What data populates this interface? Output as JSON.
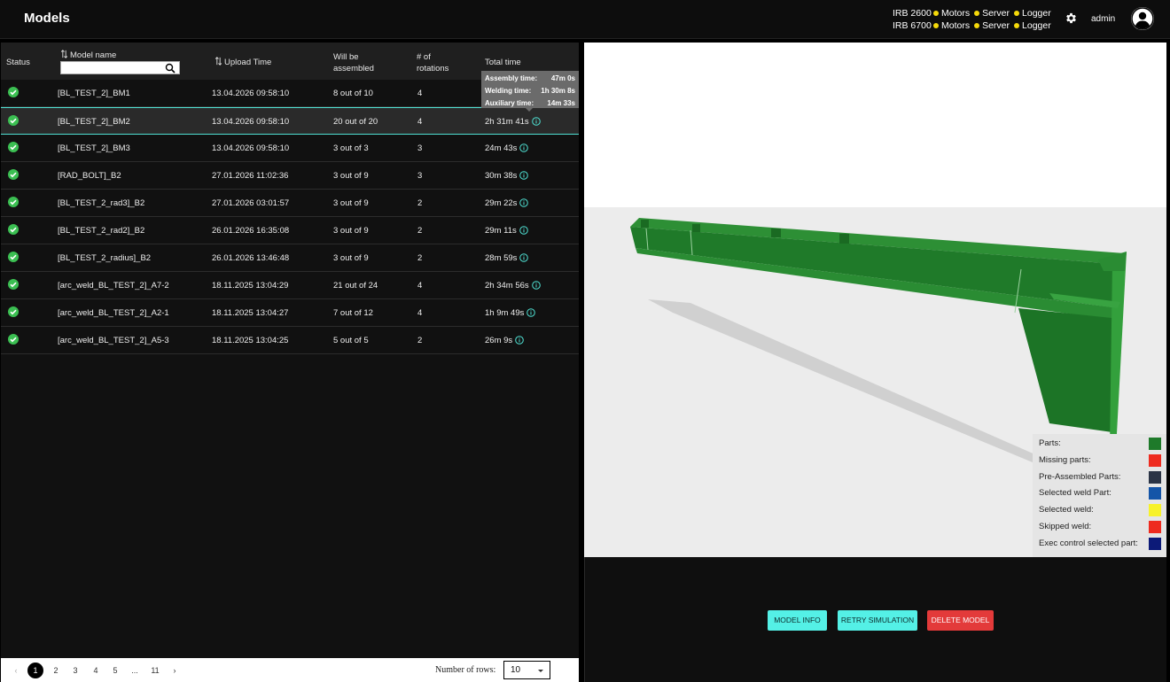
{
  "header": {
    "title": "Models",
    "robots": [
      {
        "name": "IRB 2600",
        "statuses": [
          "Motors",
          "Server",
          "Logger"
        ]
      },
      {
        "name": "IRB 6700",
        "statuses": [
          "Motors",
          "Server",
          "Logger"
        ]
      }
    ],
    "user": "admin",
    "status_color": "#f5d90a"
  },
  "table": {
    "columns": {
      "status": "Status",
      "model_name": "Model name",
      "upload_time": "Upload Time",
      "assembled_1": "Will be",
      "assembled_2": "assembled",
      "rotations_1": "# of",
      "rotations_2": "rotations",
      "total_time": "Total time"
    },
    "search_value": "",
    "rows": [
      {
        "name": "[BL_TEST_2]_BM1",
        "upload": "13.04.2026 09:58:10",
        "assembled": "8 out of 10",
        "rotations": "4",
        "total": ""
      },
      {
        "name": "[BL_TEST_2]_BM2",
        "upload": "13.04.2026 09:58:10",
        "assembled": "20 out of 20",
        "rotations": "4",
        "total": "2h 31m 41s"
      },
      {
        "name": "[BL_TEST_2]_BM3",
        "upload": "13.04.2026 09:58:10",
        "assembled": "3 out of 3",
        "rotations": "3",
        "total": "24m 43s"
      },
      {
        "name": "[RAD_BOLT]_B2",
        "upload": "27.01.2026 11:02:36",
        "assembled": "3 out of 9",
        "rotations": "3",
        "total": "30m 38s"
      },
      {
        "name": "[BL_TEST_2_rad3]_B2",
        "upload": "27.01.2026 03:01:57",
        "assembled": "3 out of 9",
        "rotations": "2",
        "total": "29m 22s"
      },
      {
        "name": "[BL_TEST_2_rad2]_B2",
        "upload": "26.01.2026 16:35:08",
        "assembled": "3 out of 9",
        "rotations": "2",
        "total": "29m 11s"
      },
      {
        "name": "[BL_TEST_2_radius]_B2",
        "upload": "26.01.2026 13:46:48",
        "assembled": "3 out of 9",
        "rotations": "2",
        "total": "28m 59s"
      },
      {
        "name": "[arc_weld_BL_TEST_2]_A7-2",
        "upload": "18.11.2025 13:04:29",
        "assembled": "21 out of 24",
        "rotations": "4",
        "total": "2h 34m 56s"
      },
      {
        "name": "[arc_weld_BL_TEST_2]_A2-1",
        "upload": "18.11.2025 13:04:27",
        "assembled": "7 out of 12",
        "rotations": "4",
        "total": "1h 9m 49s"
      },
      {
        "name": "[arc_weld_BL_TEST_2]_A5-3",
        "upload": "18.11.2025 13:04:25",
        "assembled": "5 out of 5",
        "rotations": "2",
        "total": "26m 9s"
      }
    ],
    "selected_index": 1,
    "tooltip": [
      {
        "label": "Assembly time:",
        "value": "47m 0s"
      },
      {
        "label": "Welding time:",
        "value": "1h 30m 8s"
      },
      {
        "label": "Auxiliary time:",
        "value": "14m 33s"
      }
    ]
  },
  "pagination": {
    "prev": "‹",
    "pages": [
      "1",
      "2",
      "3",
      "4",
      "5",
      "...",
      "11"
    ],
    "next": "›",
    "current": "1",
    "rows_label": "Number of rows:",
    "rows_value": "10"
  },
  "legend": [
    {
      "label": "Parts:",
      "color": "#1e7a2a"
    },
    {
      "label": "Missing parts:",
      "color": "#ee2b1f"
    },
    {
      "label": "Pre-Assembled Parts:",
      "color": "#2b3445"
    },
    {
      "label": "Selected weld Part:",
      "color": "#1455a8"
    },
    {
      "label": "Selected weld:",
      "color": "#f7f22a"
    },
    {
      "label": "Skipped weld:",
      "color": "#ee2b1f"
    },
    {
      "label": "Exec control selected part:",
      "color": "#0c1a78"
    }
  ],
  "actions": {
    "model_info": "MODEL INFO",
    "retry": "RETRY SIMULATION",
    "delete": "DELETE MODEL"
  }
}
